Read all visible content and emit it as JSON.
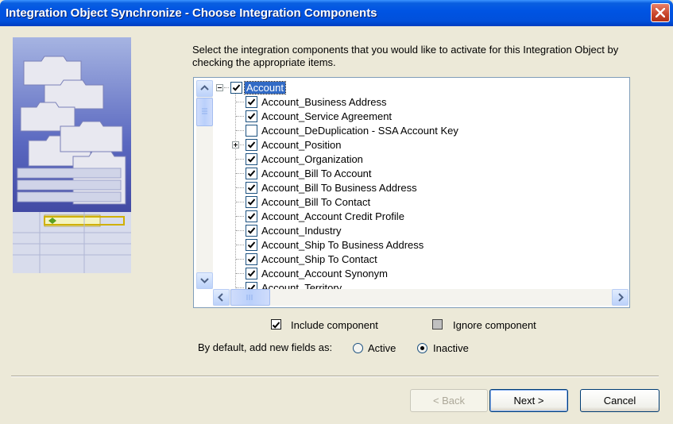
{
  "window": {
    "title": "Integration Object Synchronize - Choose Integration Components"
  },
  "instructions": "Select the integration components that you would like to activate for this Integration Object by checking the appropriate items.",
  "tree": {
    "root": {
      "label": "Account",
      "checked": true,
      "expanded": true
    },
    "items": [
      {
        "label": "Account_Business Address",
        "checked": true,
        "has_children": false
      },
      {
        "label": "Account_Service Agreement",
        "checked": true,
        "has_children": false
      },
      {
        "label": "Account_DeDuplication - SSA Account Key",
        "checked": false,
        "has_children": false
      },
      {
        "label": "Account_Position",
        "checked": true,
        "has_children": true
      },
      {
        "label": "Account_Organization",
        "checked": true,
        "has_children": false
      },
      {
        "label": "Account_Bill To Account",
        "checked": true,
        "has_children": false
      },
      {
        "label": "Account_Bill To Business Address",
        "checked": true,
        "has_children": false
      },
      {
        "label": "Account_Bill To Contact",
        "checked": true,
        "has_children": false
      },
      {
        "label": "Account_Account Credit Profile",
        "checked": true,
        "has_children": false
      },
      {
        "label": "Account_Industry",
        "checked": true,
        "has_children": false
      },
      {
        "label": "Account_Ship To Business Address",
        "checked": true,
        "has_children": false
      },
      {
        "label": "Account_Ship To Contact",
        "checked": true,
        "has_children": false
      },
      {
        "label": "Account_Account Synonym",
        "checked": true,
        "has_children": false
      },
      {
        "label": "Account_Territory",
        "checked": true,
        "has_children": false
      }
    ]
  },
  "legend": {
    "include": "Include component",
    "ignore": "Ignore component"
  },
  "default_fields": {
    "label": "By default, add new fields as:",
    "options": [
      "Active",
      "Inactive"
    ],
    "selected": "Inactive"
  },
  "buttons": {
    "back": "< Back",
    "next": "Next >",
    "cancel": "Cancel"
  }
}
